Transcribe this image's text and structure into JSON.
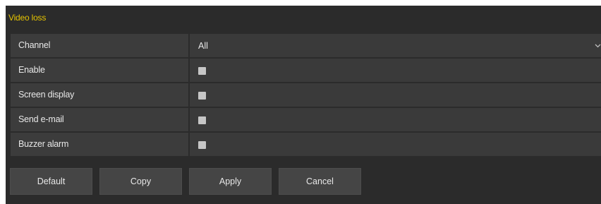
{
  "panel": {
    "title": "Video loss"
  },
  "settings": {
    "channel": {
      "label": "Channel",
      "value": "All"
    },
    "enable": {
      "label": "Enable",
      "checked": false
    },
    "screen_display": {
      "label": "Screen display",
      "checked": false
    },
    "send_email": {
      "label": "Send e-mail",
      "checked": false
    },
    "buzzer_alarm": {
      "label": "Buzzer alarm",
      "checked": false
    }
  },
  "buttons": {
    "default": "Default",
    "copy": "Copy",
    "apply": "Apply",
    "cancel": "Cancel"
  },
  "colors": {
    "title": "#e5c300",
    "panel_background": "#2b2b2b",
    "checkbox": "#c6c6c6"
  }
}
